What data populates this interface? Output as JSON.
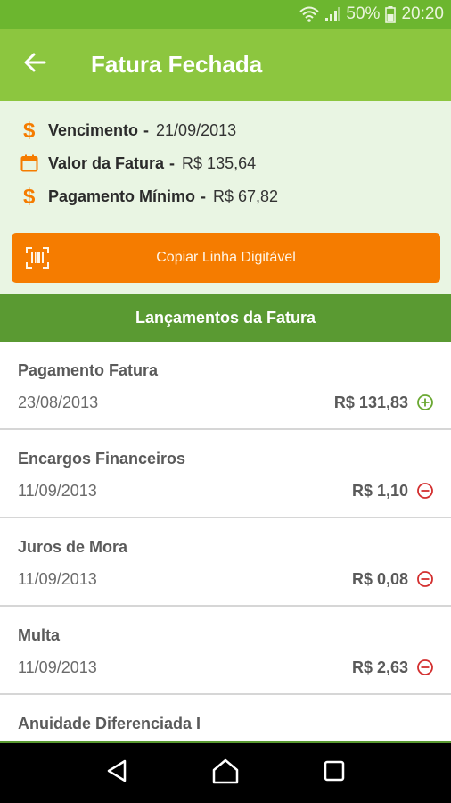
{
  "status_bar": {
    "battery": "50%",
    "time": "20:20",
    "wifi_icon": "wifi-icon",
    "signal_icon": "signal-icon",
    "battery_icon": "battery-icon"
  },
  "app_bar": {
    "title": "Fatura Fechada",
    "back_icon": "arrow-back-icon"
  },
  "summary": {
    "rows": [
      {
        "label": "Vencimento",
        "sep": "-",
        "value": "21/09/2013",
        "icon": "dollar-icon"
      },
      {
        "label": "Valor da Fatura",
        "sep": "-",
        "value": "R$ 135,64",
        "icon": "calendar-icon"
      },
      {
        "label": "Pagamento Mínimo",
        "sep": "-",
        "value": "R$ 67,82",
        "icon": "dollar-icon"
      }
    ],
    "copy_button": {
      "label": "Copiar Linha Digitável",
      "icon": "barcode-icon"
    }
  },
  "section_title": "Lançamentos da Fatura",
  "items": [
    {
      "description": "Pagamento Fatura",
      "date": "23/08/2013",
      "amount": "R$ 131,83",
      "type": "credit"
    },
    {
      "description": "Encargos Financeiros",
      "date": "11/09/2013",
      "amount": "R$ 1,10",
      "type": "debit"
    },
    {
      "description": "Juros de Mora",
      "date": "11/09/2013",
      "amount": "R$ 0,08",
      "type": "debit"
    },
    {
      "description": "Multa",
      "date": "11/09/2013",
      "amount": "R$ 2,63",
      "type": "debit"
    },
    {
      "description": "Anuidade Diferenciada I",
      "date": "",
      "amount": "",
      "type": "debit"
    }
  ],
  "colors": {
    "primary": "#8cc63f",
    "status": "#6cb62f",
    "accent": "#f57c00",
    "section": "#5a9a32",
    "credit": "#6aa832",
    "debit": "#d32f2f"
  }
}
